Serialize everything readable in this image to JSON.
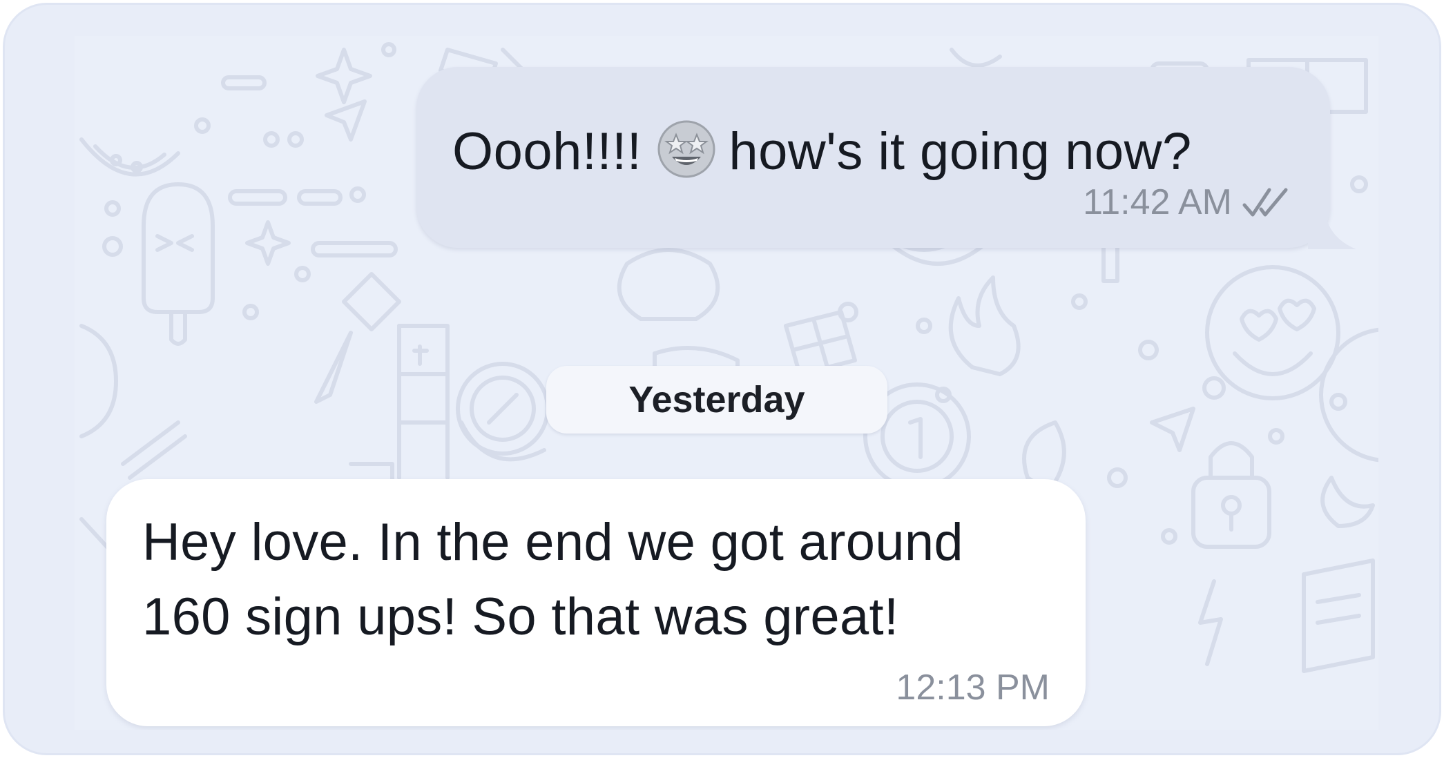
{
  "conversation": {
    "outgoing_message": {
      "text_before_emoji": "Oooh!!!!",
      "emoji": "star-struck-emoji",
      "text_after_emoji": "how's it going now?",
      "time": "11:42 AM",
      "status_icon": "double-check-icon"
    },
    "date_separator": "Yesterday",
    "incoming_message": {
      "text": "Hey love. In the end we got around 160 sign ups! So that was great!",
      "time": "12:13 PM"
    }
  },
  "colors": {
    "frame_background": "#e8edf8",
    "chat_background": "#eaeff9",
    "outgoing_bubble": "#dfe4f1",
    "incoming_bubble": "#ffffff",
    "meta_text": "#8a909c"
  }
}
